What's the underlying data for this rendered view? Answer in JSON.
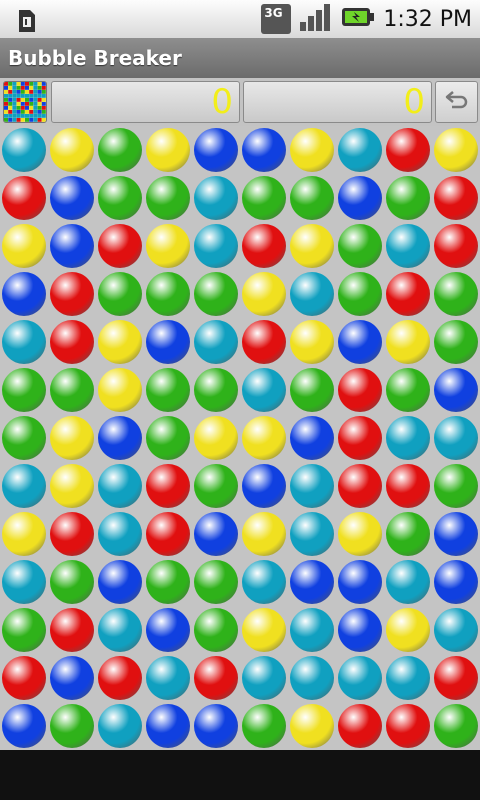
{
  "status_bar": {
    "time": "1:32 PM",
    "network_label": "3G",
    "icons": [
      "sim-card-icon",
      "network-3g-icon",
      "signal-bars-icon",
      "battery-icon"
    ]
  },
  "app": {
    "title": "Bubble Breaker"
  },
  "toolbar": {
    "score": "0",
    "previous_score": "0",
    "thumbnail_icon": "board-thumbnail-icon",
    "undo_icon": "undo-arrow-icon"
  },
  "colors": {
    "red": "#e01010",
    "yellow": "#f0e020",
    "green": "#2fb21a",
    "blue": "#1040e0",
    "cyan": "#10a0c0",
    "score_text": "#f2ee1a",
    "board_bg": "#c4c4c4"
  },
  "board": {
    "columns": 10,
    "rows": 13,
    "grid": [
      [
        "cyan",
        "yellow",
        "green",
        "yellow",
        "blue",
        "blue",
        "yellow",
        "cyan",
        "red",
        "yellow"
      ],
      [
        "red",
        "blue",
        "green",
        "green",
        "cyan",
        "green",
        "green",
        "blue",
        "green",
        "red"
      ],
      [
        "yellow",
        "blue",
        "red",
        "yellow",
        "cyan",
        "red",
        "yellow",
        "green",
        "cyan",
        "red"
      ],
      [
        "blue",
        "red",
        "green",
        "green",
        "green",
        "yellow",
        "cyan",
        "green",
        "red",
        "green"
      ],
      [
        "cyan",
        "red",
        "yellow",
        "blue",
        "cyan",
        "red",
        "yellow",
        "blue",
        "yellow",
        "green"
      ],
      [
        "green",
        "green",
        "yellow",
        "green",
        "green",
        "cyan",
        "green",
        "red",
        "green",
        "blue"
      ],
      [
        "green",
        "yellow",
        "blue",
        "green",
        "yellow",
        "yellow",
        "blue",
        "red",
        "cyan",
        "cyan"
      ],
      [
        "cyan",
        "yellow",
        "cyan",
        "red",
        "green",
        "blue",
        "cyan",
        "red",
        "red",
        "green"
      ],
      [
        "yellow",
        "red",
        "cyan",
        "red",
        "blue",
        "yellow",
        "cyan",
        "yellow",
        "green",
        "blue"
      ],
      [
        "cyan",
        "green",
        "blue",
        "green",
        "green",
        "cyan",
        "blue",
        "blue",
        "cyan",
        "blue"
      ],
      [
        "green",
        "red",
        "cyan",
        "blue",
        "green",
        "yellow",
        "cyan",
        "blue",
        "yellow",
        "cyan"
      ],
      [
        "red",
        "blue",
        "red",
        "cyan",
        "red",
        "cyan",
        "cyan",
        "cyan",
        "cyan",
        "red"
      ],
      [
        "blue",
        "green",
        "cyan",
        "blue",
        "blue",
        "green",
        "yellow",
        "red",
        "red",
        "green"
      ]
    ]
  }
}
